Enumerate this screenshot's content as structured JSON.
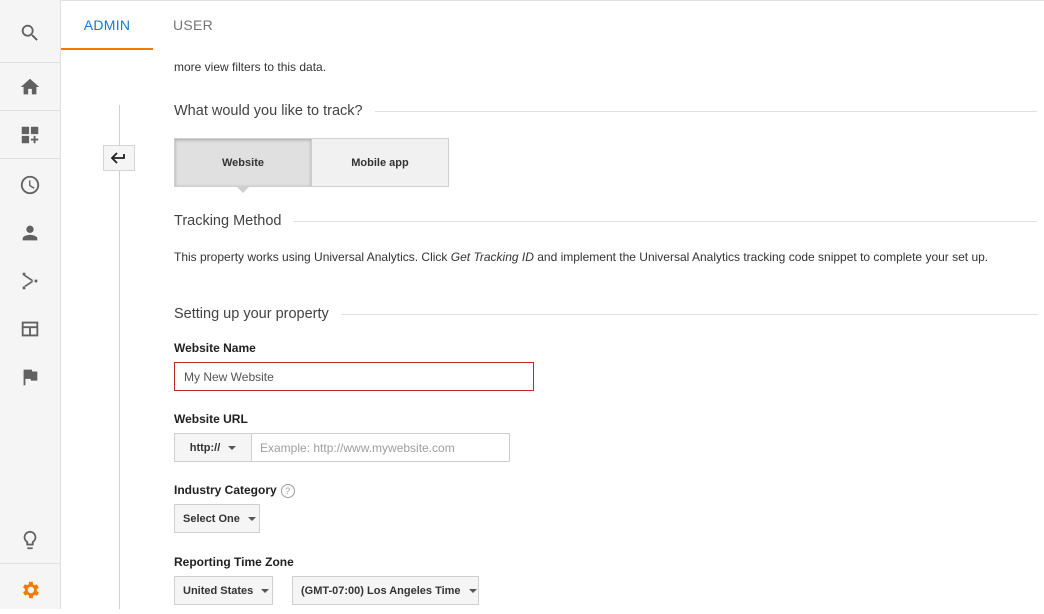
{
  "tabs": {
    "admin": "ADMIN",
    "user": "USER"
  },
  "sidebar": {
    "items": [
      {
        "icon": "search-icon"
      },
      {
        "icon": "home-icon"
      },
      {
        "icon": "customization-icon"
      },
      {
        "icon": "clock-icon"
      },
      {
        "icon": "person-icon"
      },
      {
        "icon": "acquisition-icon"
      },
      {
        "icon": "behavior-icon"
      },
      {
        "icon": "flag-icon"
      },
      {
        "icon": "lightbulb-icon"
      },
      {
        "icon": "gear-icon"
      }
    ],
    "gear_color": "#f57c00"
  },
  "intro_text": "more view filters to this data.",
  "track": {
    "heading": "What would you like to track?",
    "website_label": "Website",
    "mobile_label": "Mobile app"
  },
  "tracking_method": {
    "heading": "Tracking Method",
    "text_before": "This property works using Universal Analytics. Click ",
    "text_em": "Get Tracking ID",
    "text_after": " and implement the Universal Analytics tracking code snippet to complete your set up."
  },
  "setup": {
    "heading": "Setting up your property",
    "website_name_label": "Website Name",
    "website_name_value": "My New Website",
    "website_url_label": "Website URL",
    "protocol_value": "http://",
    "url_placeholder": "Example: http://www.mywebsite.com",
    "industry_label": "Industry Category",
    "help_glyph": "?",
    "industry_value": "Select One",
    "timezone_label": "Reporting Time Zone",
    "country_value": "United States",
    "timezone_value": "(GMT-07:00) Los Angeles Time"
  },
  "colors": {
    "accent_blue": "#1976d2",
    "accent_orange": "#f57c00",
    "error_red": "#c62828"
  }
}
